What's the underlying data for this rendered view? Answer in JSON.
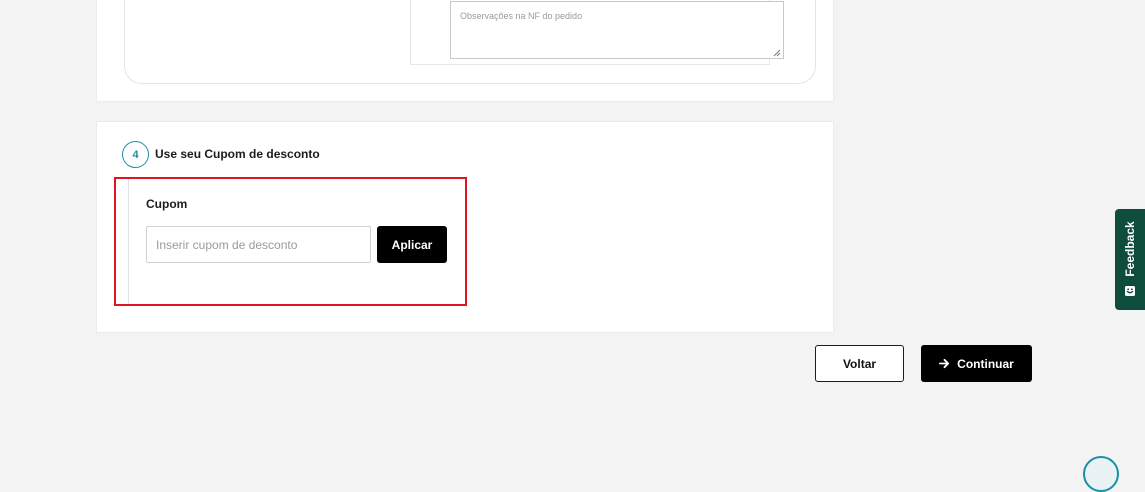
{
  "observations": {
    "placeholder": "Observações na NF do pedido"
  },
  "coupon_section": {
    "step_number": "4",
    "title": "Use seu Cupom de desconto",
    "field_label": "Cupom",
    "input_placeholder": "Inserir cupom de desconto",
    "apply_label": "Aplicar",
    "highlight_color": "#e0151f",
    "accent_color": "#1a8fa6"
  },
  "actions": {
    "back_label": "Voltar",
    "continue_label": "Continuar",
    "continue_icon": "arrow-right-icon"
  },
  "feedback": {
    "label": "Feedback",
    "icon": "feedback-icon",
    "color": "#0e4d3b"
  }
}
